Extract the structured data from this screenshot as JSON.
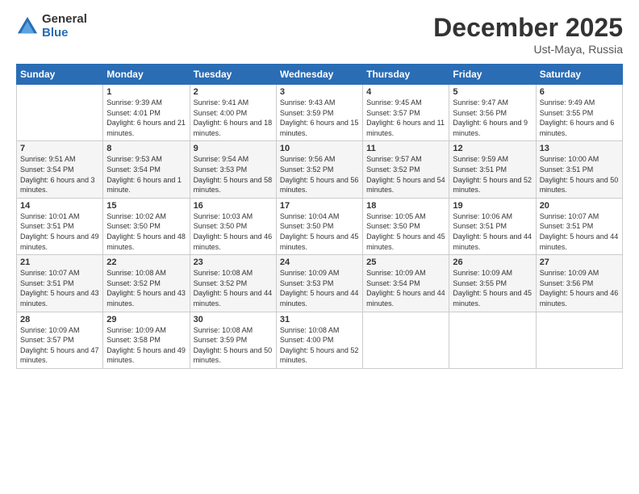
{
  "logo": {
    "general": "General",
    "blue": "Blue"
  },
  "header": {
    "title": "December 2025",
    "subtitle": "Ust-Maya, Russia"
  },
  "weekdays": [
    "Sunday",
    "Monday",
    "Tuesday",
    "Wednesday",
    "Thursday",
    "Friday",
    "Saturday"
  ],
  "weeks": [
    [
      {
        "day": "",
        "sunrise": "",
        "sunset": "",
        "daylight": ""
      },
      {
        "day": "1",
        "sunrise": "Sunrise: 9:39 AM",
        "sunset": "Sunset: 4:01 PM",
        "daylight": "Daylight: 6 hours and 21 minutes."
      },
      {
        "day": "2",
        "sunrise": "Sunrise: 9:41 AM",
        "sunset": "Sunset: 4:00 PM",
        "daylight": "Daylight: 6 hours and 18 minutes."
      },
      {
        "day": "3",
        "sunrise": "Sunrise: 9:43 AM",
        "sunset": "Sunset: 3:59 PM",
        "daylight": "Daylight: 6 hours and 15 minutes."
      },
      {
        "day": "4",
        "sunrise": "Sunrise: 9:45 AM",
        "sunset": "Sunset: 3:57 PM",
        "daylight": "Daylight: 6 hours and 11 minutes."
      },
      {
        "day": "5",
        "sunrise": "Sunrise: 9:47 AM",
        "sunset": "Sunset: 3:56 PM",
        "daylight": "Daylight: 6 hours and 9 minutes."
      },
      {
        "day": "6",
        "sunrise": "Sunrise: 9:49 AM",
        "sunset": "Sunset: 3:55 PM",
        "daylight": "Daylight: 6 hours and 6 minutes."
      }
    ],
    [
      {
        "day": "7",
        "sunrise": "Sunrise: 9:51 AM",
        "sunset": "Sunset: 3:54 PM",
        "daylight": "Daylight: 6 hours and 3 minutes."
      },
      {
        "day": "8",
        "sunrise": "Sunrise: 9:53 AM",
        "sunset": "Sunset: 3:54 PM",
        "daylight": "Daylight: 6 hours and 1 minute."
      },
      {
        "day": "9",
        "sunrise": "Sunrise: 9:54 AM",
        "sunset": "Sunset: 3:53 PM",
        "daylight": "Daylight: 5 hours and 58 minutes."
      },
      {
        "day": "10",
        "sunrise": "Sunrise: 9:56 AM",
        "sunset": "Sunset: 3:52 PM",
        "daylight": "Daylight: 5 hours and 56 minutes."
      },
      {
        "day": "11",
        "sunrise": "Sunrise: 9:57 AM",
        "sunset": "Sunset: 3:52 PM",
        "daylight": "Daylight: 5 hours and 54 minutes."
      },
      {
        "day": "12",
        "sunrise": "Sunrise: 9:59 AM",
        "sunset": "Sunset: 3:51 PM",
        "daylight": "Daylight: 5 hours and 52 minutes."
      },
      {
        "day": "13",
        "sunrise": "Sunrise: 10:00 AM",
        "sunset": "Sunset: 3:51 PM",
        "daylight": "Daylight: 5 hours and 50 minutes."
      }
    ],
    [
      {
        "day": "14",
        "sunrise": "Sunrise: 10:01 AM",
        "sunset": "Sunset: 3:51 PM",
        "daylight": "Daylight: 5 hours and 49 minutes."
      },
      {
        "day": "15",
        "sunrise": "Sunrise: 10:02 AM",
        "sunset": "Sunset: 3:50 PM",
        "daylight": "Daylight: 5 hours and 48 minutes."
      },
      {
        "day": "16",
        "sunrise": "Sunrise: 10:03 AM",
        "sunset": "Sunset: 3:50 PM",
        "daylight": "Daylight: 5 hours and 46 minutes."
      },
      {
        "day": "17",
        "sunrise": "Sunrise: 10:04 AM",
        "sunset": "Sunset: 3:50 PM",
        "daylight": "Daylight: 5 hours and 45 minutes."
      },
      {
        "day": "18",
        "sunrise": "Sunrise: 10:05 AM",
        "sunset": "Sunset: 3:50 PM",
        "daylight": "Daylight: 5 hours and 45 minutes."
      },
      {
        "day": "19",
        "sunrise": "Sunrise: 10:06 AM",
        "sunset": "Sunset: 3:51 PM",
        "daylight": "Daylight: 5 hours and 44 minutes."
      },
      {
        "day": "20",
        "sunrise": "Sunrise: 10:07 AM",
        "sunset": "Sunset: 3:51 PM",
        "daylight": "Daylight: 5 hours and 44 minutes."
      }
    ],
    [
      {
        "day": "21",
        "sunrise": "Sunrise: 10:07 AM",
        "sunset": "Sunset: 3:51 PM",
        "daylight": "Daylight: 5 hours and 43 minutes."
      },
      {
        "day": "22",
        "sunrise": "Sunrise: 10:08 AM",
        "sunset": "Sunset: 3:52 PM",
        "daylight": "Daylight: 5 hours and 43 minutes."
      },
      {
        "day": "23",
        "sunrise": "Sunrise: 10:08 AM",
        "sunset": "Sunset: 3:52 PM",
        "daylight": "Daylight: 5 hours and 44 minutes."
      },
      {
        "day": "24",
        "sunrise": "Sunrise: 10:09 AM",
        "sunset": "Sunset: 3:53 PM",
        "daylight": "Daylight: 5 hours and 44 minutes."
      },
      {
        "day": "25",
        "sunrise": "Sunrise: 10:09 AM",
        "sunset": "Sunset: 3:54 PM",
        "daylight": "Daylight: 5 hours and 44 minutes."
      },
      {
        "day": "26",
        "sunrise": "Sunrise: 10:09 AM",
        "sunset": "Sunset: 3:55 PM",
        "daylight": "Daylight: 5 hours and 45 minutes."
      },
      {
        "day": "27",
        "sunrise": "Sunrise: 10:09 AM",
        "sunset": "Sunset: 3:56 PM",
        "daylight": "Daylight: 5 hours and 46 minutes."
      }
    ],
    [
      {
        "day": "28",
        "sunrise": "Sunrise: 10:09 AM",
        "sunset": "Sunset: 3:57 PM",
        "daylight": "Daylight: 5 hours and 47 minutes."
      },
      {
        "day": "29",
        "sunrise": "Sunrise: 10:09 AM",
        "sunset": "Sunset: 3:58 PM",
        "daylight": "Daylight: 5 hours and 49 minutes."
      },
      {
        "day": "30",
        "sunrise": "Sunrise: 10:08 AM",
        "sunset": "Sunset: 3:59 PM",
        "daylight": "Daylight: 5 hours and 50 minutes."
      },
      {
        "day": "31",
        "sunrise": "Sunrise: 10:08 AM",
        "sunset": "Sunset: 4:00 PM",
        "daylight": "Daylight: 5 hours and 52 minutes."
      },
      {
        "day": "",
        "sunrise": "",
        "sunset": "",
        "daylight": ""
      },
      {
        "day": "",
        "sunrise": "",
        "sunset": "",
        "daylight": ""
      },
      {
        "day": "",
        "sunrise": "",
        "sunset": "",
        "daylight": ""
      }
    ]
  ]
}
